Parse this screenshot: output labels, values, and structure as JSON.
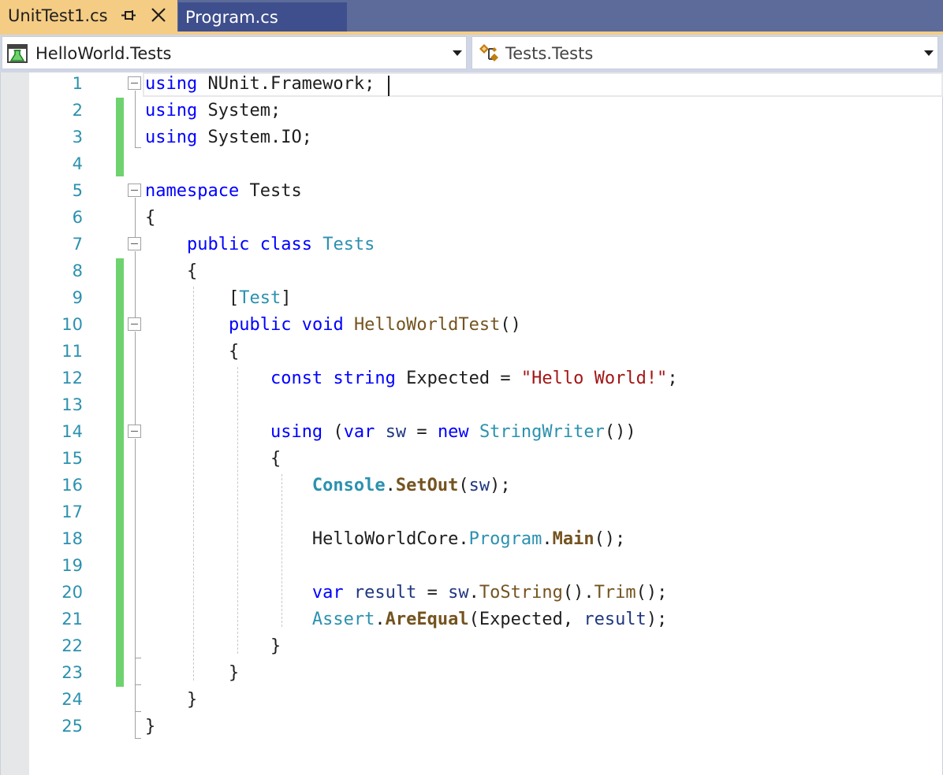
{
  "tabs": [
    {
      "label": "UnitTest1.cs",
      "active": true,
      "pinned": true
    },
    {
      "label": "Program.cs",
      "active": false
    }
  ],
  "navbar": {
    "project": {
      "label": "HelloWorld.Tests",
      "icon": "test-project-icon"
    },
    "type": {
      "label": "Tests.Tests",
      "icon": "class-icon"
    }
  },
  "colors": {
    "tab_active": "#f5cc84",
    "tab_inactive": "#3f4f8d",
    "tab_strip": "#5c6b99",
    "keyword": "#0000ff",
    "type": "#2b91af",
    "string": "#a31515",
    "method": "#74531f",
    "change_bar": "#6ed36e"
  },
  "editor": {
    "line_numbers": [
      "1",
      "2",
      "3",
      "4",
      "5",
      "6",
      "7",
      "8",
      "9",
      "10",
      "11",
      "12",
      "13",
      "14",
      "15",
      "16",
      "17",
      "18",
      "19",
      "20",
      "21",
      "22",
      "23",
      "24",
      "25"
    ],
    "lines": [
      [
        [
          "kw",
          "using"
        ],
        [
          "pl",
          " NUnit.Framework;"
        ]
      ],
      [
        [
          "kw",
          "using"
        ],
        [
          "pl",
          " System;"
        ]
      ],
      [
        [
          "kw",
          "using"
        ],
        [
          "pl",
          " System.IO;"
        ]
      ],
      [],
      [
        [
          "kw",
          "namespace"
        ],
        [
          "pl",
          " Tests"
        ]
      ],
      [
        [
          "pl",
          "{"
        ]
      ],
      [
        [
          "pl",
          "    "
        ],
        [
          "kw",
          "public"
        ],
        [
          "pl",
          " "
        ],
        [
          "kw",
          "class"
        ],
        [
          "pl",
          " "
        ],
        [
          "ty",
          "Tests"
        ]
      ],
      [
        [
          "pl",
          "    {"
        ]
      ],
      [
        [
          "pl",
          "        ["
        ],
        [
          "ty",
          "Test"
        ],
        [
          "pl",
          "]"
        ]
      ],
      [
        [
          "pl",
          "        "
        ],
        [
          "kw",
          "public"
        ],
        [
          "pl",
          " "
        ],
        [
          "kw",
          "void"
        ],
        [
          "pl",
          " "
        ],
        [
          "fn",
          "HelloWorldTest"
        ],
        [
          "pl",
          "()"
        ]
      ],
      [
        [
          "pl",
          "        {"
        ]
      ],
      [
        [
          "pl",
          "            "
        ],
        [
          "kw",
          "const"
        ],
        [
          "pl",
          " "
        ],
        [
          "kw",
          "string"
        ],
        [
          "pl",
          " Expected = "
        ],
        [
          "st",
          "\"Hello World!\""
        ],
        [
          "pl",
          ";"
        ]
      ],
      [],
      [
        [
          "pl",
          "            "
        ],
        [
          "kw",
          "using"
        ],
        [
          "pl",
          " ("
        ],
        [
          "kw",
          "var"
        ],
        [
          "pl",
          " "
        ],
        [
          "lo",
          "sw"
        ],
        [
          "pl",
          " = "
        ],
        [
          "kw",
          "new"
        ],
        [
          "pl",
          " "
        ],
        [
          "ty",
          "StringWriter"
        ],
        [
          "pl",
          "())"
        ]
      ],
      [
        [
          "pl",
          "            {"
        ]
      ],
      [
        [
          "pl",
          "                "
        ],
        [
          "tyb",
          "Console"
        ],
        [
          "pl",
          "."
        ],
        [
          "fnb",
          "SetOut"
        ],
        [
          "pl",
          "("
        ],
        [
          "lo",
          "sw"
        ],
        [
          "pl",
          ");"
        ]
      ],
      [],
      [
        [
          "pl",
          "                HelloWorldCore."
        ],
        [
          "ty",
          "Program"
        ],
        [
          "pl",
          "."
        ],
        [
          "fnb",
          "Main"
        ],
        [
          "pl",
          "();"
        ]
      ],
      [],
      [
        [
          "pl",
          "                "
        ],
        [
          "kw",
          "var"
        ],
        [
          "pl",
          " "
        ],
        [
          "lo",
          "result"
        ],
        [
          "pl",
          " = "
        ],
        [
          "lo",
          "sw"
        ],
        [
          "pl",
          "."
        ],
        [
          "fn",
          "ToString"
        ],
        [
          "pl",
          "()."
        ],
        [
          "fn",
          "Trim"
        ],
        [
          "pl",
          "();"
        ]
      ],
      [
        [
          "pl",
          "                "
        ],
        [
          "ty",
          "Assert"
        ],
        [
          "pl",
          "."
        ],
        [
          "fnb",
          "AreEqual"
        ],
        [
          "pl",
          "(Expected, "
        ],
        [
          "lo",
          "result"
        ],
        [
          "pl",
          ");"
        ]
      ],
      [
        [
          "pl",
          "            }"
        ]
      ],
      [
        [
          "pl",
          "        }"
        ]
      ],
      [
        [
          "pl",
          "    }"
        ]
      ],
      [
        [
          "pl",
          "}"
        ]
      ]
    ]
  }
}
